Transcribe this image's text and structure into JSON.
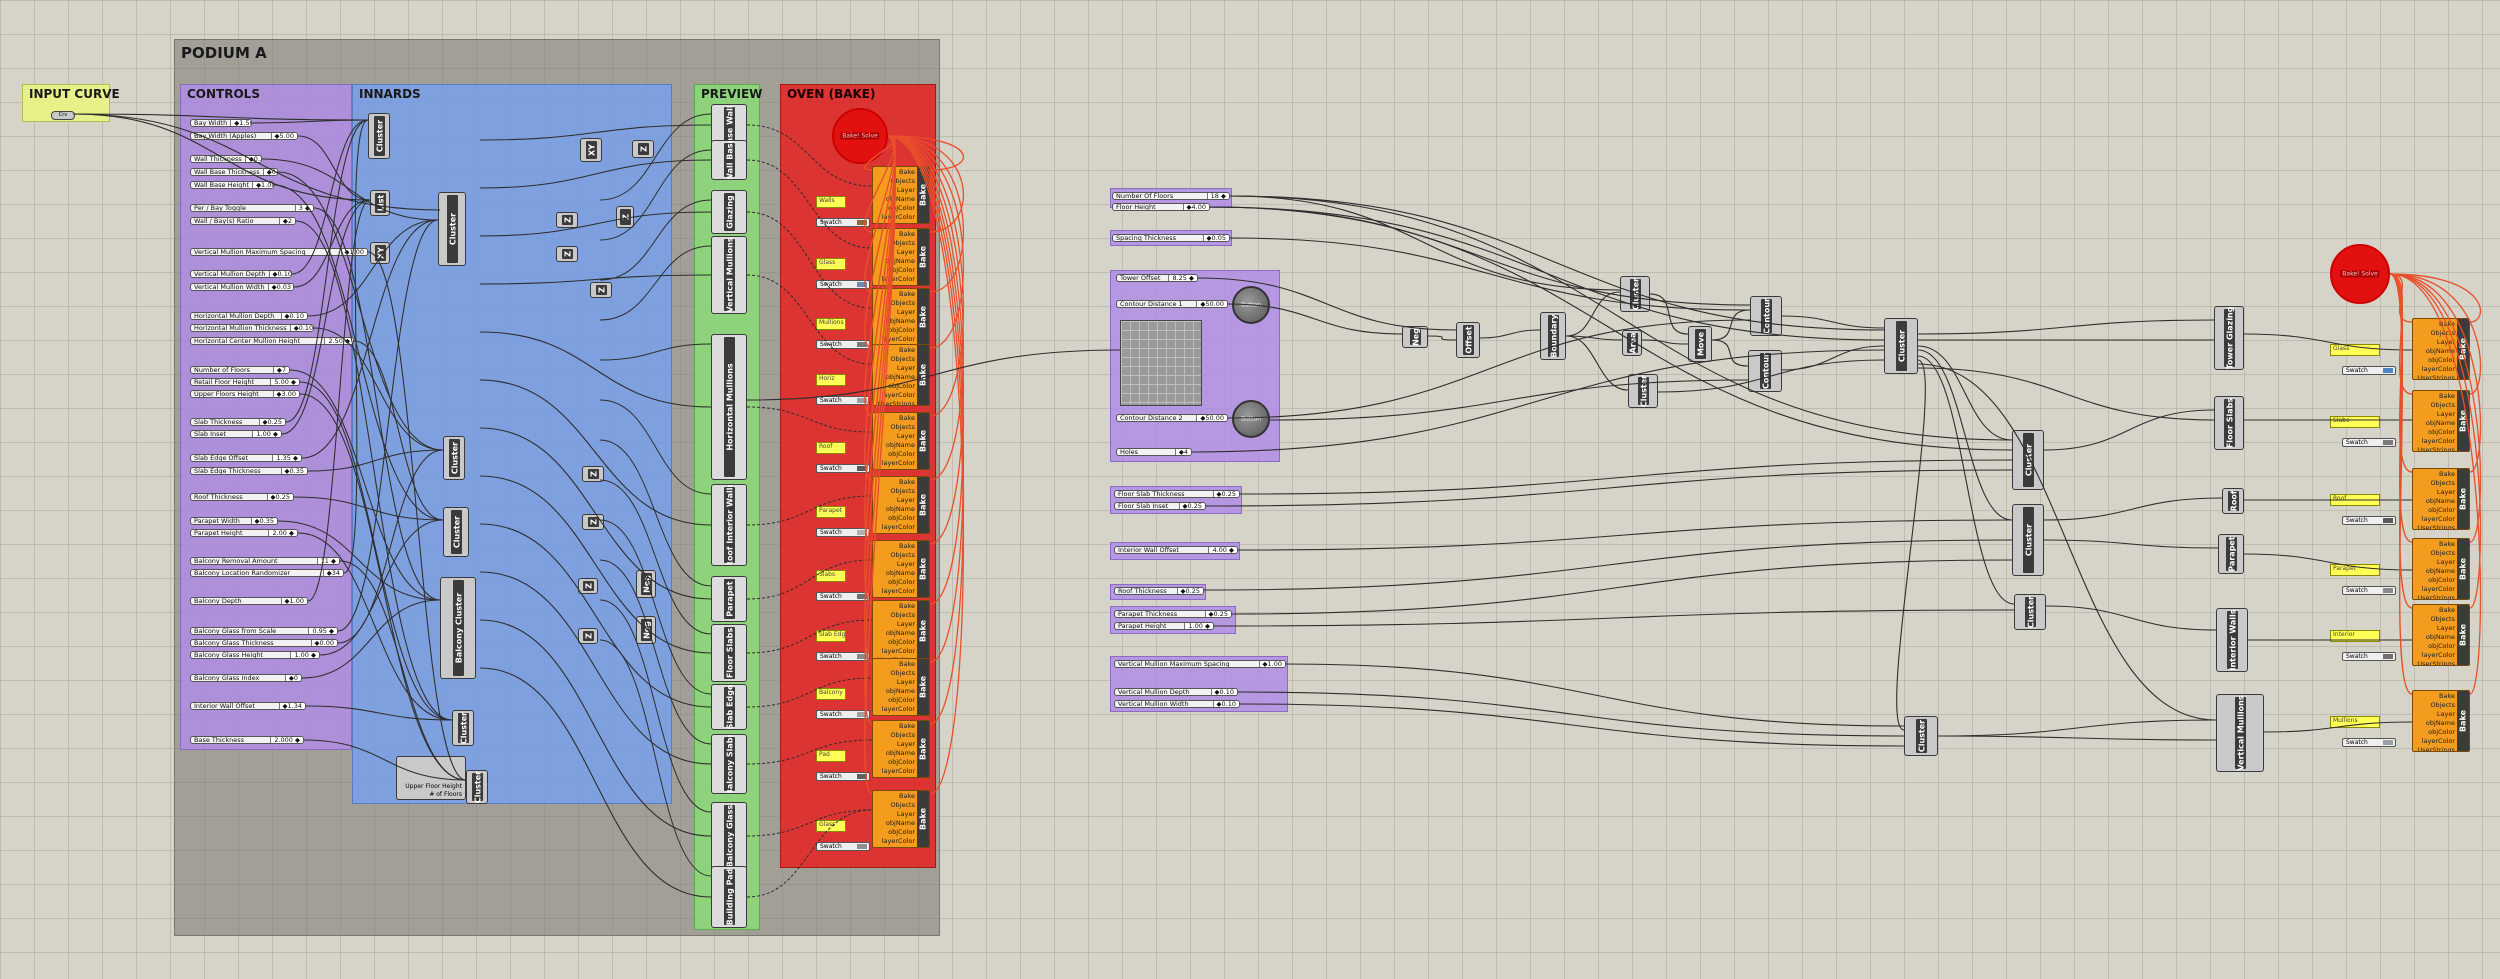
{
  "groups": {
    "podium": "PODIUM A",
    "controls": "CONTROLS",
    "innards": "INNARDS",
    "preview": "PREVIEW",
    "oven": "OVEN (BAKE)",
    "input": "INPUT CURVE"
  },
  "input_param": "Crv",
  "controls_sliders": [
    {
      "label": "Bay Width",
      "value": "◆1.500"
    },
    {
      "label": "Bay Width (Apples)",
      "value": "◆5.00"
    },
    {
      "label": "Wall Thickness",
      "value": "◆0.25"
    },
    {
      "label": "Wall Base Thickness",
      "value": "◆0.35"
    },
    {
      "label": "Wall Base Height",
      "value": "◆1.00"
    },
    {
      "label": "Per / Bay Toggle",
      "value": "3 ◆"
    },
    {
      "label": "Wall / Bay(s) Ratio",
      "value": "◆2"
    },
    {
      "label": "Vertical Mullion Maximum Spacing",
      "value": "◆1.00"
    },
    {
      "label": "Vertical Mullion Depth",
      "value": "◆0.10"
    },
    {
      "label": "Vertical Mullion Width",
      "value": "◆0.03"
    },
    {
      "label": "Horizontal Mullion Depth",
      "value": "◆0.10"
    },
    {
      "label": "Horizontal Mullion Thickness",
      "value": "◆0.10"
    },
    {
      "label": "Horizontal Center Mullion Height",
      "value": "2.50 ◆"
    },
    {
      "label": "Number of Floors",
      "value": "◆7"
    },
    {
      "label": "Retail Floor Height",
      "value": "5.00 ◆"
    },
    {
      "label": "Upper Floors Height",
      "value": "◆3.00"
    },
    {
      "label": "Slab Thickness",
      "value": "◆0.25"
    },
    {
      "label": "Slab Inset",
      "value": "1.00 ◆"
    },
    {
      "label": "Slab Edge Offset",
      "value": "1.35 ◆"
    },
    {
      "label": "Slab Edge Thickness",
      "value": "◆0.35"
    },
    {
      "label": "Roof Thickness",
      "value": "◆0.25"
    },
    {
      "label": "Parapet Width",
      "value": "◆0.35"
    },
    {
      "label": "Parapet Height",
      "value": "2.00 ◆"
    },
    {
      "label": "Balcony Removal Amount",
      "value": "11 ◆"
    },
    {
      "label": "Balcony Location Randomizer",
      "value": "◆34"
    },
    {
      "label": "Balcony Depth",
      "value": "◆1.00"
    },
    {
      "label": "Balcony Glass from Scale",
      "value": "0.95 ◆"
    },
    {
      "label": "Balcony Glass Thickness",
      "value": "◆0.00"
    },
    {
      "label": "Balcony Glass Height",
      "value": "1.00 ◆"
    },
    {
      "label": "Balcony Glass Index",
      "value": "◆0"
    },
    {
      "label": "Interior Wall Offset",
      "value": "◆1.34"
    },
    {
      "label": "Base Thickness",
      "value": "2.000 ◆"
    }
  ],
  "innards": {
    "clusters": [
      "Cluster",
      "Cluster",
      "Cluster",
      "Cluster",
      "Balcony Cluster",
      "Cluster",
      "Cluster"
    ],
    "ops": [
      "List",
      "XY",
      "Neg",
      "Z",
      "Z",
      "Z",
      "Z",
      "Z",
      "Z",
      "Z",
      "Z",
      "Z",
      "Neg",
      "Neg",
      "Z"
    ],
    "note": "Upper Floor Height\n# of Floors"
  },
  "preview_items": [
    "Base Walls",
    "Wall Base",
    "Glazing",
    "Vertical Mullions",
    "Horizontal Mullions",
    "Roof Interior Walls",
    "Parapet",
    "Floor Slabs",
    "Slab Edge",
    "Balcony Slabs",
    "Balcony Glass",
    "Building Pad"
  ],
  "preview_brep": "Brep",
  "bake_ports": [
    "Bake",
    "Objects",
    "Layer",
    "objName",
    "objColor",
    "layerColor",
    "UserStrings",
    "UserKeys"
  ],
  "bake_side": "Bake",
  "oven": {
    "button": "Bake! Solve",
    "panels": [
      "Walls",
      "Glass",
      "Mullions",
      "Horiz",
      "Roof",
      "Parapet",
      "Slabs",
      "Slab Edge",
      "Balcony",
      "Pad",
      "Glass",
      "Pad"
    ],
    "swatch_label": "Swatch"
  },
  "right": {
    "sliders_top": [
      {
        "label": "Number Of Floors",
        "value": "18 ◆"
      },
      {
        "label": "Floor Height",
        "value": "◆4.00"
      }
    ],
    "spacing": {
      "label": "Spacing Thickness",
      "value": "◆0.05"
    },
    "tower": [
      {
        "label": "Tower Offset",
        "value": "8.25 ◆"
      },
      {
        "label": "Contour Distance 1",
        "value": "◆50.00"
      },
      {
        "label": "Contour Distance 2",
        "value": "◆50.00"
      },
      {
        "label": "Holes",
        "value": "◆4"
      }
    ],
    "knobs": [
      "Button",
      "Button"
    ],
    "floor_slabs": [
      {
        "label": "Floor Slab Thickness",
        "value": "◆0.25"
      },
      {
        "label": "Floor Slab Inset",
        "value": "◆0.25"
      }
    ],
    "interior": {
      "label": "Interior Wall Offset",
      "value": "4.00 ◆"
    },
    "roof": {
      "label": "Roof Thickness",
      "value": "◆0.25"
    },
    "parapet": [
      {
        "label": "Parapet Thickness",
        "value": "◆0.25"
      },
      {
        "label": "Parapet Height",
        "value": "1.00 ◆"
      }
    ],
    "mullions": [
      {
        "label": "Vertical Mullion Maximum Spacing",
        "value": "◆1.00"
      },
      {
        "label": "Vertical Mullion Depth",
        "value": "◆0.10"
      },
      {
        "label": "Vertical Mullion Width",
        "value": "◆0.10"
      }
    ],
    "components": [
      "Neg",
      "Offset",
      "Boundary",
      "Cluster",
      "Area",
      "Cluster",
      "Move",
      "Contour",
      "Contour",
      "Cluster",
      "Cluster",
      "Cluster",
      "Cluster",
      "Cluster",
      "Tower Glazing",
      "Floor Slabs",
      "Roof",
      "Parapet",
      "Interior Walls",
      "Vertical Mullions",
      "Cluster"
    ],
    "button": "Bake! Solve",
    "panels": [
      "Glass",
      "Slabs",
      "Roof",
      "Parapet",
      "Interior",
      "Mullions"
    ],
    "swatch_label": "Swatch"
  },
  "colors": {
    "controls": "#af8ce6",
    "innards": "#78a0eb",
    "preview": "#8cd778",
    "oven": "#e12828",
    "input": "#e8f08a",
    "bake": "#f39c1e",
    "wire_dark": "#2e2e2e",
    "wire_orange": "#e8502a"
  }
}
